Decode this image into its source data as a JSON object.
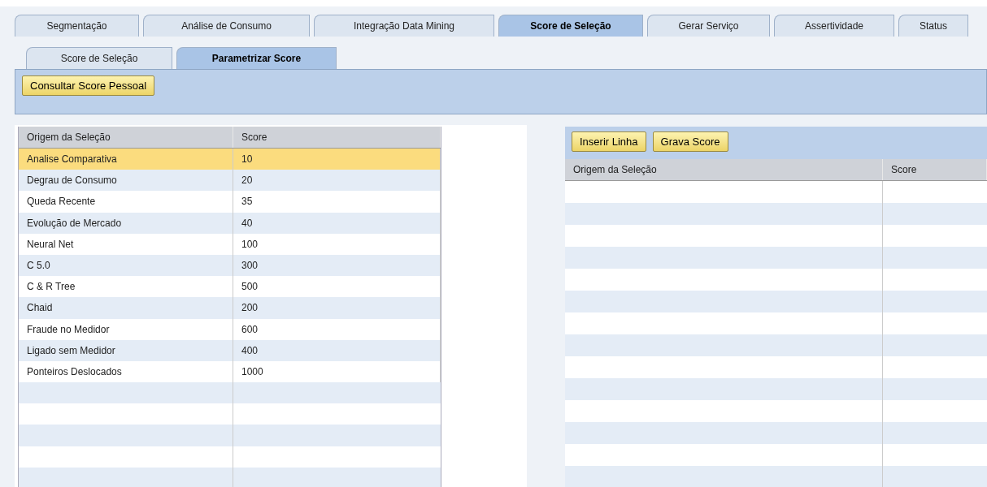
{
  "tabs": [
    {
      "label": "Segmentação",
      "selected": false
    },
    {
      "label": "Análise de Consumo",
      "selected": false
    },
    {
      "label": "Integração Data Mining",
      "selected": false
    },
    {
      "label": "Score de Seleção",
      "selected": true
    },
    {
      "label": "Gerar Serviço",
      "selected": false
    },
    {
      "label": "Assertividade",
      "selected": false
    },
    {
      "label": "Status",
      "selected": false
    }
  ],
  "subtabs": [
    {
      "label": "Score de Seleção",
      "selected": false
    },
    {
      "label": "Parametrizar Score",
      "selected": true
    }
  ],
  "toolbar": {
    "buttons": [
      "Consultar Score Pessoal"
    ]
  },
  "score_table": {
    "columns": [
      "Origem da Seleção",
      "Score"
    ],
    "rows": [
      {
        "origin": "Analise Comparativa",
        "score": "10",
        "selected": true
      },
      {
        "origin": "Degrau de Consumo",
        "score": "20",
        "selected": false
      },
      {
        "origin": "Queda Recente",
        "score": "35",
        "selected": false
      },
      {
        "origin": "Evolução de Mercado",
        "score": "40",
        "selected": false
      },
      {
        "origin": "Neural Net",
        "score": "100",
        "selected": false
      },
      {
        "origin": "C 5.0",
        "score": "300",
        "selected": false
      },
      {
        "origin": "C & R Tree",
        "score": "500",
        "selected": false
      },
      {
        "origin": "Chaid",
        "score": "200",
        "selected": false
      },
      {
        "origin": "Fraude no Medidor",
        "score": "600",
        "selected": false
      },
      {
        "origin": "Ligado sem Medidor",
        "score": "400",
        "selected": false
      },
      {
        "origin": "Ponteiros Deslocados",
        "score": "1000",
        "selected": false
      }
    ]
  },
  "edit_panel": {
    "buttons": [
      "Inserir Linha",
      "Grava Score"
    ],
    "columns": [
      "Origem da Seleção",
      "Score"
    ]
  }
}
